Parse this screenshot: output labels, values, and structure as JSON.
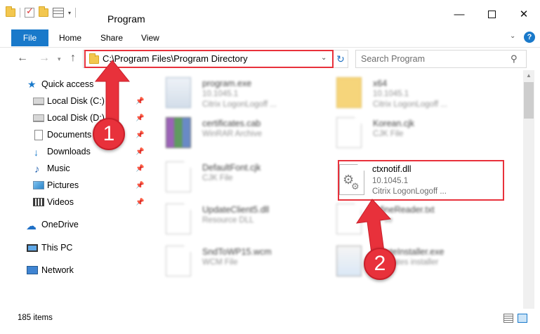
{
  "window": {
    "title": "Program",
    "minimize_glyph": "—",
    "close_glyph": "✕"
  },
  "ribbon": {
    "tabs": [
      "File",
      "Home",
      "Share",
      "View"
    ],
    "help_glyph": "?"
  },
  "address": {
    "path": "C:\\Program Files\\Program Directory"
  },
  "search": {
    "placeholder": "Search Program"
  },
  "sidebar": {
    "items": [
      {
        "label": "Quick access",
        "icon": "star-icon"
      },
      {
        "label": "Local Disk (C:)",
        "icon": "disk-icon",
        "pinned": true
      },
      {
        "label": "Local Disk (D:)",
        "icon": "disk-icon",
        "pinned": true
      },
      {
        "label": "Documents",
        "icon": "documents-icon",
        "pinned": true
      },
      {
        "label": "Downloads",
        "icon": "download-icon",
        "pinned": true
      },
      {
        "label": "Music",
        "icon": "music-icon",
        "pinned": true
      },
      {
        "label": "Pictures",
        "icon": "pictures-icon",
        "pinned": true
      },
      {
        "label": "Videos",
        "icon": "videos-icon",
        "pinned": true
      },
      {
        "label": "OneDrive",
        "icon": "cloud-icon"
      },
      {
        "label": "This PC",
        "icon": "computer-icon",
        "selected": true
      },
      {
        "label": "Network",
        "icon": "network-icon"
      }
    ]
  },
  "files": [
    {
      "name": "program.exe",
      "line1": "10.1045.1",
      "line2": "Citrix LogonLogoff ...",
      "icon": "exe-icon",
      "blurred": true
    },
    {
      "name": "x64",
      "line1": "10.1045.1",
      "line2": "Citrix LogonLogoff ...",
      "icon": "folder-icon",
      "blurred": true
    },
    {
      "name": "certificates.cab",
      "line1": "WinRAR Archive",
      "line2": "",
      "icon": "archive-icon",
      "blurred": true
    },
    {
      "name": "Korean.cjk",
      "line1": "CJK File",
      "line2": "",
      "icon": "file-icon",
      "blurred": true
    },
    {
      "name": "DefaultFont.cjk",
      "line1": "CJK File",
      "line2": "",
      "icon": "file-icon",
      "blurred": true
    },
    {
      "name": "ctxnotif.dll",
      "line1": "10.1045.1",
      "line2": "Citrix LogonLogoff ...",
      "icon": "dll-icon",
      "blurred": false
    },
    {
      "name": "UpdateClient5.dll",
      "line1": "Resource DLL",
      "line2": "",
      "icon": "dll-icon",
      "blurred": true
    },
    {
      "name": "...fineReader.txt",
      "line1": "...File",
      "line2": "",
      "icon": "file-icon",
      "blurred": true
    },
    {
      "name": "SndToWP15.wcm",
      "line1": "WCM File",
      "line2": "",
      "icon": "file-icon",
      "blurred": true
    },
    {
      "name": "...dateInstaller.exe",
      "line1": "...updates installer",
      "line2": "",
      "icon": "installer-icon",
      "blurred": true
    }
  ],
  "status": {
    "item_count": "185 items"
  },
  "callouts": [
    {
      "number": "1"
    },
    {
      "number": "2"
    }
  ],
  "colors": {
    "accent": "#1979ca",
    "highlight_red": "#e8313b"
  }
}
